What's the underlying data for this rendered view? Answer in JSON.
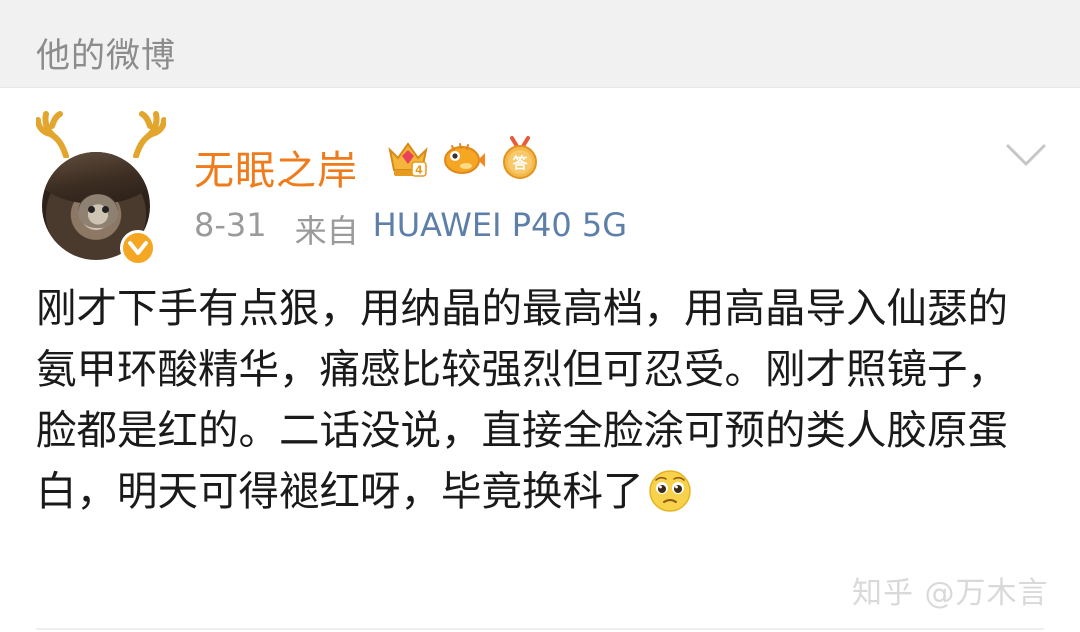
{
  "section": {
    "title": "他的微博"
  },
  "post": {
    "author": {
      "name": "无眠之岸",
      "badges": [
        "vip-crown-icon",
        "pufferfish-icon",
        "answer-medal-icon"
      ],
      "answer_badge_text": "答",
      "vip_level_text": "4",
      "verified_color": "#f5a623"
    },
    "date": "8-31",
    "source_prefix": "来自",
    "device": "HUAWEI P40 5G",
    "text": "刚才下手有点狠，用纳晶的最高档，用高晶导入仙瑟的氨甲环酸精华，痛感比较强烈但可忍受。刚才照镜子，脸都是红的。二话没说，直接全脸涂可预的类人胶原蛋白，明天可得褪红呀，毕竟换科了",
    "emoji": "pleading-face-icon"
  },
  "watermark": "知乎 @万木言",
  "colors": {
    "username": "#f07b1a",
    "device_link": "#5d7fa8",
    "meta": "#9a9a9a",
    "header_bg": "#f1f1f1"
  }
}
